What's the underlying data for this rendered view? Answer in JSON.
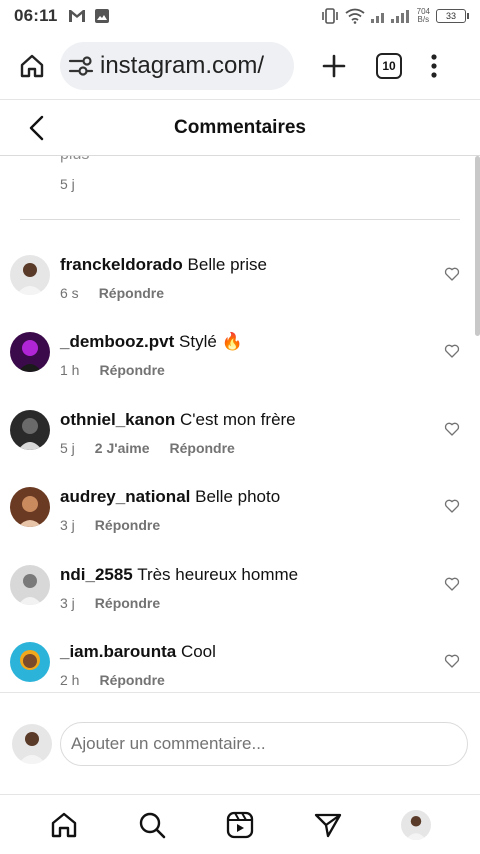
{
  "status_bar": {
    "time": "06:11",
    "net_speed_value": "704",
    "net_speed_unit": "B/s",
    "battery": "33"
  },
  "browser": {
    "url": "instagram.com/",
    "tab_count": "10"
  },
  "header": {
    "title": "Commentaires"
  },
  "previous_comment": {
    "tail_text": "plus",
    "time": "5 j"
  },
  "comments": [
    {
      "user": "franckeldorado",
      "text": "Belle prise",
      "time": "6 s",
      "likes": "",
      "reply": "Répondre",
      "avatar_color": "#dcdcdc"
    },
    {
      "user": "_dembooz.pvt",
      "text": "Stylé 🔥",
      "time": "1 h",
      "likes": "",
      "reply": "Répondre",
      "avatar_color": "#7a1fa2"
    },
    {
      "user": "othniel_kanon",
      "text": "C'est mon frère",
      "time": "5 j",
      "likes": "2 J'aime",
      "reply": "Répondre",
      "avatar_color": "#3a3a3a"
    },
    {
      "user": "audrey_national",
      "text": "Belle photo",
      "time": "3 j",
      "likes": "",
      "reply": "Répondre",
      "avatar_color": "#8a4a2a"
    },
    {
      "user": "ndi_2585",
      "text": "Très heureux homme",
      "time": "3 j",
      "likes": "",
      "reply": "Répondre",
      "avatar_color": "#b8b8b8"
    },
    {
      "user": "_iam.barounta",
      "text": "Cool",
      "time": "2 h",
      "likes": "",
      "reply": "Répondre",
      "avatar_color": "#f2a81d"
    }
  ],
  "input": {
    "placeholder": "Ajouter un commentaire..."
  },
  "colors": {
    "muted": "#737373",
    "divider": "#dbdbdb"
  }
}
